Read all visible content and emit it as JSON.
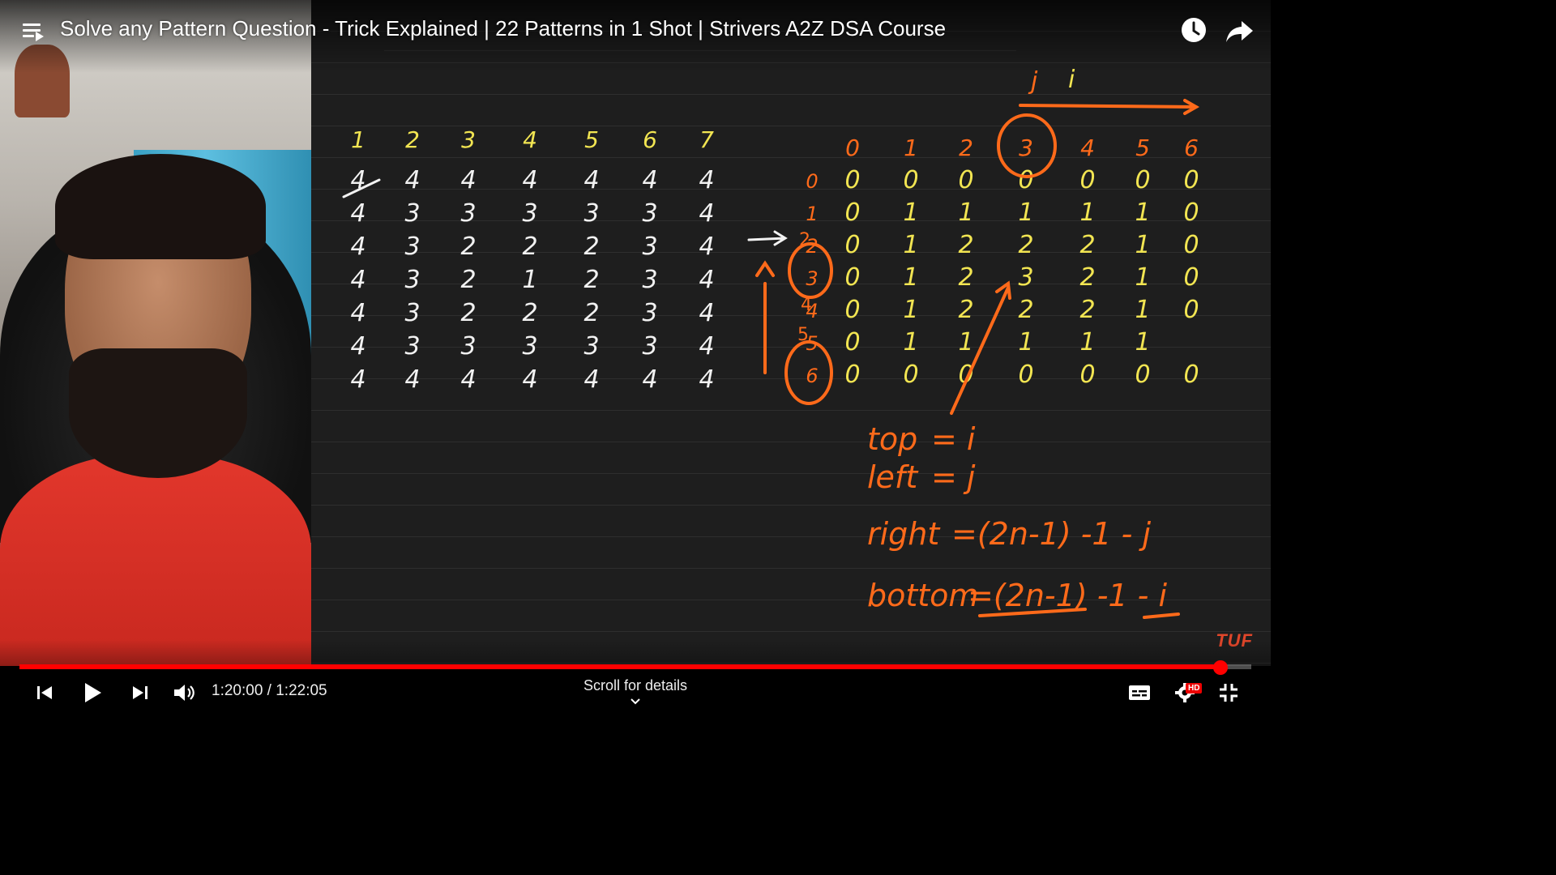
{
  "header": {
    "title": "Solve any Pattern Question - Trick Explained | 22 Patterns in 1 Shot | Strivers A2Z DSA Course",
    "watch_later_icon": "clock-icon",
    "share_icon": "share-arrow-icon",
    "menu_icon": "playlist-icon"
  },
  "board": {
    "column_headers": [
      "1",
      "2",
      "3",
      "4",
      "5",
      "6",
      "7"
    ],
    "pattern_rows": [
      [
        "4",
        "4",
        "4",
        "4",
        "4",
        "4",
        "4"
      ],
      [
        "4",
        "3",
        "3",
        "3",
        "3",
        "3",
        "4"
      ],
      [
        "4",
        "3",
        "2",
        "2",
        "2",
        "3",
        "4"
      ],
      [
        "4",
        "3",
        "2",
        "1",
        "2",
        "3",
        "4"
      ],
      [
        "4",
        "3",
        "2",
        "2",
        "2",
        "3",
        "4"
      ],
      [
        "4",
        "3",
        "3",
        "3",
        "3",
        "3",
        "4"
      ],
      [
        "4",
        "4",
        "4",
        "4",
        "4",
        "4",
        "4"
      ]
    ],
    "index_headers": [
      "0",
      "1",
      "2",
      "3",
      "4",
      "5",
      "6"
    ],
    "row_indices": [
      "0",
      "1",
      "2",
      "3",
      "4",
      "5",
      "6"
    ],
    "distance_rows": [
      [
        "0",
        "0",
        "0",
        "0",
        "0",
        "0",
        "0"
      ],
      [
        "0",
        "1",
        "1",
        "1",
        "1",
        "1",
        "0"
      ],
      [
        "0",
        "1",
        "2",
        "2",
        "2",
        "1",
        "0"
      ],
      [
        "0",
        "1",
        "2",
        "3",
        "2",
        "1",
        "0"
      ],
      [
        "0",
        "1",
        "2",
        "2",
        "2",
        "1",
        "0"
      ],
      [
        "0",
        "1",
        "1",
        "1",
        "1",
        "1",
        ""
      ],
      [
        "0",
        "0",
        "0",
        "0",
        "0",
        "0",
        "0"
      ]
    ],
    "marks": [
      "j",
      "i",
      "2",
      "4",
      "5"
    ],
    "formulas": [
      {
        "lhs": "top",
        "rhs": "= i"
      },
      {
        "lhs": "left",
        "rhs": "= j"
      },
      {
        "lhs": "right",
        "rhs": "=(2n-1) -1 - j"
      },
      {
        "lhs": "bottom",
        "rhs": "=(2n-1) -1 - i"
      }
    ],
    "watermark": "TUF",
    "colors": {
      "yellow": "#f2e552",
      "white": "#f2f2f2",
      "orange": "#ff6a1a"
    }
  },
  "player": {
    "time_display": "1:20:00 / 1:22:05",
    "progress_fraction": 0.975,
    "scroll_hint": "Scroll for details",
    "hd_badge": "HD",
    "accent": "#ff0000",
    "icons": [
      "previous-icon",
      "play-icon",
      "next-icon",
      "volume-icon",
      "subtitles-icon",
      "settings-icon",
      "exit-fullscreen-icon"
    ]
  }
}
